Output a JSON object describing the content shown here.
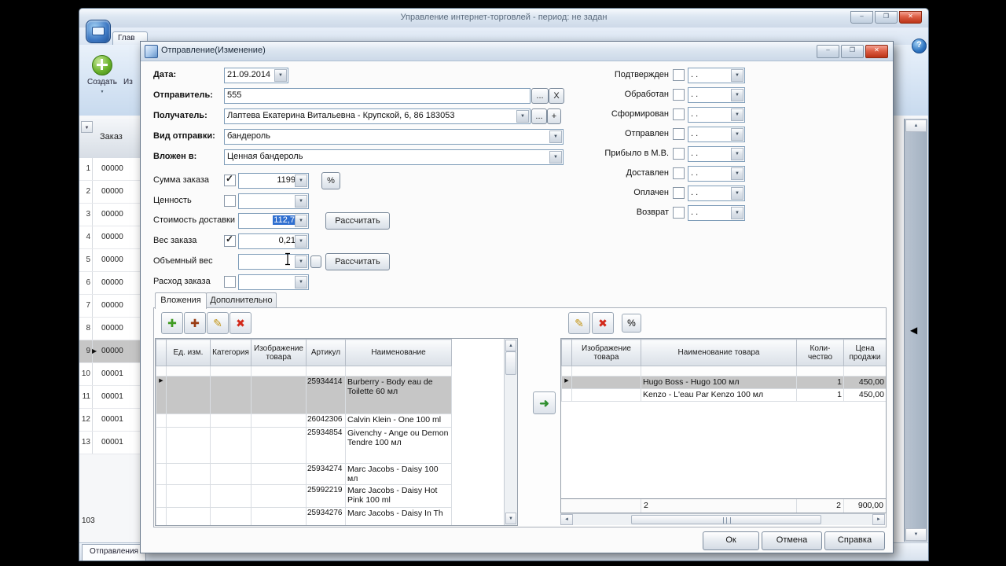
{
  "icons": {
    "add": "✚",
    "add_alt": "✚",
    "edit": "✎",
    "delete": "✖",
    "move_right": "➜",
    "row_marker": "▶",
    "panel_arrow": "◀"
  },
  "window": {
    "title": "Управление интернет-торговлей  -  период: не задан",
    "help": "?",
    "controls": {
      "minimize": "–",
      "maximize": "❐",
      "close": "✕"
    }
  },
  "background": {
    "ribbon_tab": "Глав",
    "create_button": "Создать",
    "edit_button_fragment": "Из",
    "table": {
      "header": "Заказ",
      "rows": [
        {
          "n": "1",
          "v": "00000"
        },
        {
          "n": "2",
          "v": "00000"
        },
        {
          "n": "3",
          "v": "00000"
        },
        {
          "n": "4",
          "v": "00000"
        },
        {
          "n": "5",
          "v": "00000"
        },
        {
          "n": "6",
          "v": "00000"
        },
        {
          "n": "7",
          "v": "00000"
        },
        {
          "n": "8",
          "v": "00000"
        },
        {
          "n": "9",
          "v": "00000"
        },
        {
          "n": "10",
          "v": "00001"
        },
        {
          "n": "11",
          "v": "00001"
        },
        {
          "n": "12",
          "v": "00001"
        },
        {
          "n": "13",
          "v": "00001"
        }
      ],
      "footer_count": "103"
    },
    "status_tab": "Отправления"
  },
  "dialog": {
    "title": "Отправление(Изменение)",
    "form": {
      "date_label": "Дата:",
      "date_value": "21.09.2014",
      "sender_label": "Отправитель:",
      "sender_value": "555",
      "more_button": "...",
      "clear_button": "X",
      "add_button": "+",
      "recipient_label": "Получатель:",
      "recipient_value": "Лаптева Екатерина Витальевна - Крупской, 6, 86 183053",
      "ship_type_label": "Вид отправки:",
      "ship_type_value": "бандероль",
      "enclosed_label": "Вложен в:",
      "enclosed_value": "Ценная бандероль",
      "order_sum_label": "Сумма заказа",
      "order_sum_value": "1199",
      "percent_button": "%",
      "declared_value_label": "Ценность",
      "delivery_cost_label": "Стоимость доставки",
      "delivery_cost_value": "112,7",
      "calc_button": "Рассчитать",
      "order_weight_label": "Вес заказа",
      "order_weight_value": "0,21",
      "volume_weight_label": "Объемный вес",
      "order_expense_label": "Расход заказа",
      "empty_date": " .  ."
    },
    "statuses": [
      {
        "label": "Подтвержден"
      },
      {
        "label": "Обработан"
      },
      {
        "label": "Сформирован"
      },
      {
        "label": "Отправлен"
      },
      {
        "label": "Прибыло в М.В."
      },
      {
        "label": "Доставлен"
      },
      {
        "label": "Оплачен"
      },
      {
        "label": "Возврат"
      }
    ],
    "tabs": [
      {
        "label": "Вложения"
      },
      {
        "label": "Дополнительно"
      }
    ],
    "left_grid": {
      "columns": {
        "unit": "Ед. изм.",
        "category": "Категория",
        "image": "Изображение товара",
        "article": "Артикул",
        "name": "Наименование"
      },
      "rows": [
        {
          "article": "25934414",
          "name": "Burberry - Body eau de Toilette 60 мл"
        },
        {
          "article": "26042306",
          "name": "Calvin Klein - One 100 ml"
        },
        {
          "article": "25934854",
          "name": "Givenchy - Ange ou Demon Tendre 100 мл"
        },
        {
          "article": "25934274",
          "name": "Marc Jacobs - Daisy 100 мл"
        },
        {
          "article": "25992219",
          "name": "Marc Jacobs - Daisy Hot Pink 100 ml"
        },
        {
          "article": "25934276",
          "name": "Marc Jacobs - Daisy In Th"
        }
      ]
    },
    "right_grid": {
      "percent_button": "%",
      "columns": {
        "image": "Изображение товара",
        "name": "Наименование товара",
        "qty": "Коли- чество",
        "price": "Цена продажи"
      },
      "rows": [
        {
          "name": "Hugo Boss - Hugo 100 мл",
          "qty": "1",
          "price": "450,00"
        },
        {
          "name": "Kenzo - L'eau Par Kenzo 100 мл",
          "qty": "1",
          "price": "450,00"
        }
      ],
      "totals": {
        "count": "2",
        "qty": "2",
        "price": "900,00"
      }
    },
    "buttons": {
      "ok": "Ок",
      "cancel": "Отмена",
      "help": "Справка"
    }
  }
}
